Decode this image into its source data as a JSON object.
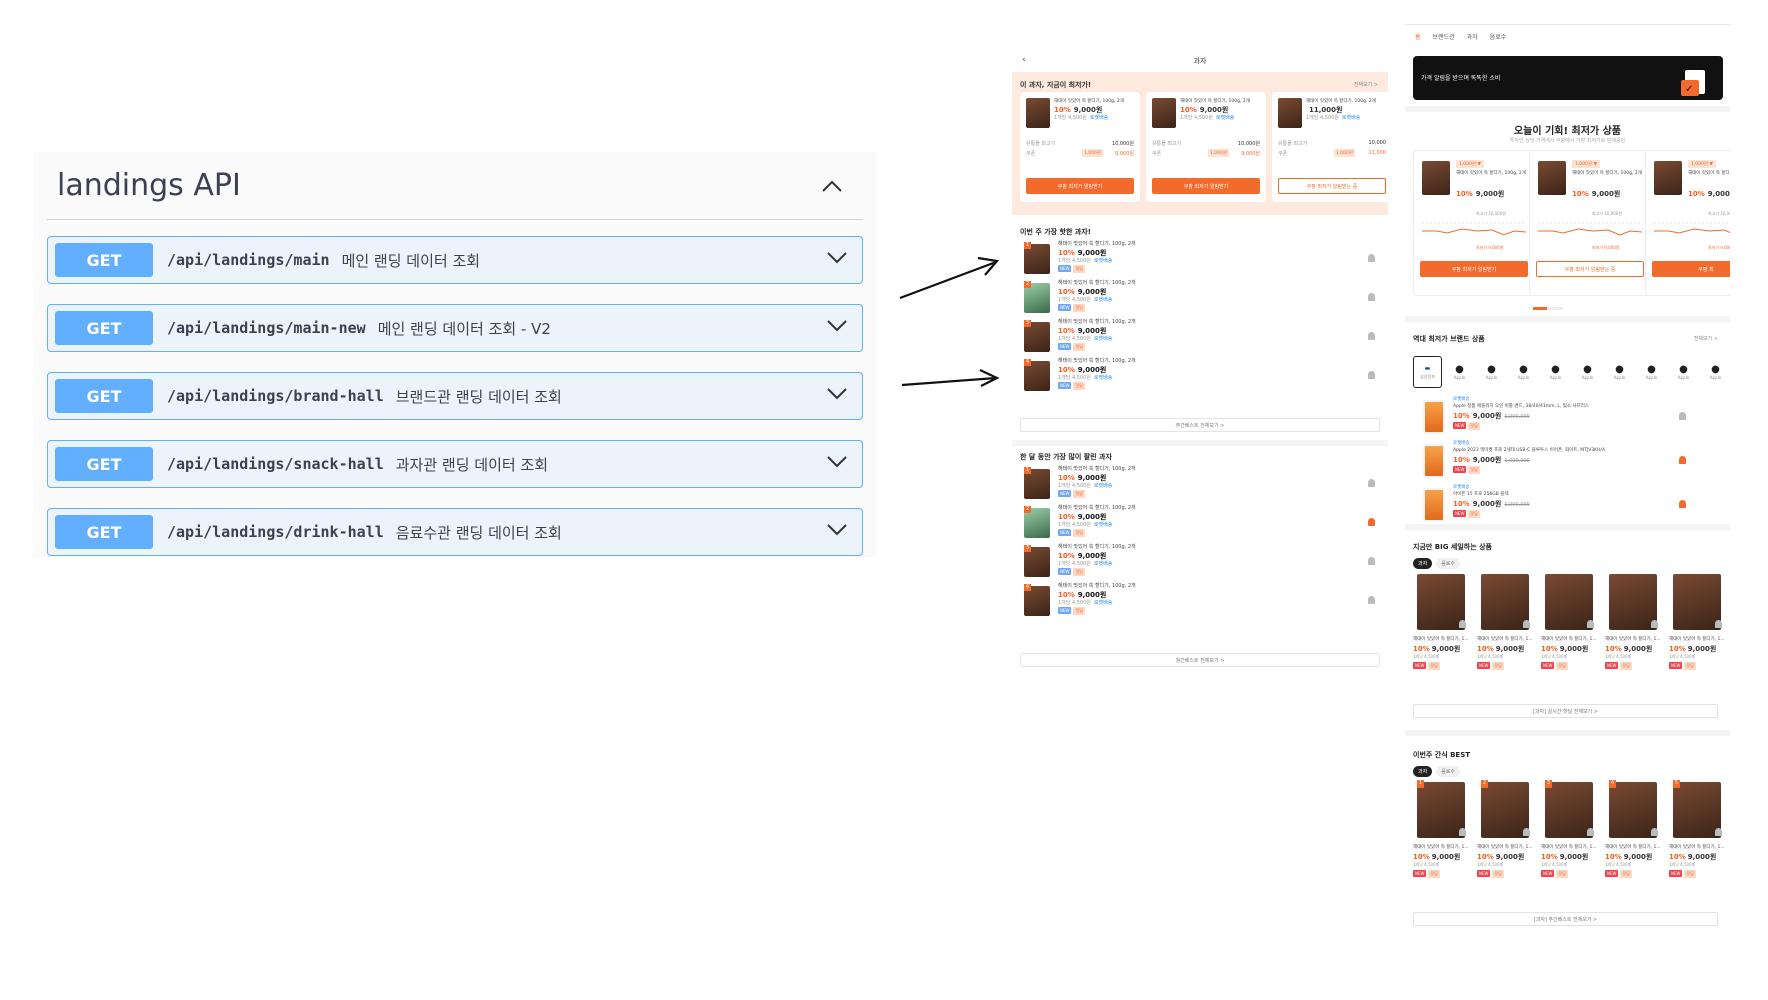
{
  "swagger": {
    "title": "landings API",
    "operations": [
      {
        "method": "GET",
        "path": "/api/landings/main",
        "description": "메인 랜딩 데이터 조회"
      },
      {
        "method": "GET",
        "path": "/api/landings/main-new",
        "description": "메인 랜딩 데이터 조회 - V2"
      },
      {
        "method": "GET",
        "path": "/api/landings/brand-hall",
        "description": "브랜드관 랜딩 데이터 조회"
      },
      {
        "method": "GET",
        "path": "/api/landings/snack-hall",
        "description": "과자관 랜딩 데이터 조회"
      },
      {
        "method": "GET",
        "path": "/api/landings/drink-hall",
        "description": "음료수관 랜딩 데이터 조회"
      }
    ]
  },
  "snack_page": {
    "header_title": "과자",
    "back_icon": "chevron-left-icon",
    "banner_title": "이 과자, 지금이 최저가!",
    "banner_more": "전체보기 >",
    "product_name": "해태이 맛있어 쏙 할디기, 100g, 2개",
    "discount": "10%",
    "price": "9,000원",
    "unit_price": "1개당 4,500원",
    "rocket": "로켓배송",
    "orig_label": "유통몰 최고가",
    "orig_value": "10,000원",
    "coupon_label": "쿠폰",
    "coupon_value": "1,000원",
    "coupon_price": "9,000원",
    "card3_price": "11,000원",
    "card3_orig": "10,000",
    "card3_coupon_price": "11,000",
    "btn_alert": "쿠팡 최저가 알림받기",
    "btn_alert_on": "쿠팡 최저가 알림받는 중",
    "week_title": "이번 주 가장 핫한 과자!",
    "week_more": "주간베스트 전체보기 >",
    "month_title": "한 달 동안 가장 많이 팔린 과자",
    "month_more": "월간베스트 전체보기 >",
    "tag_new": "NEW",
    "tag_hot": "핫딜"
  },
  "main_page": {
    "nav": [
      "홈",
      "브랜드관",
      "과자",
      "음료수"
    ],
    "hero_text": "가격 알림을 받으며 똑똑한 소비",
    "today_title": "오늘이 기회! 최저가 상품",
    "today_sub": "투자인 상당 가격에서 쿠팡에서 가장 최저가로 판매중인",
    "low_badge": "1,000원 ▼",
    "low_name": "해태이 맛있어 쏙 할디기, 100g, 2개",
    "low_discount": "10%",
    "low_price": "9,000원",
    "low_high": "최고가 10,000원",
    "low_low": "최저가 9,000원",
    "btn_alert": "쿠팡 최저가 알림받기",
    "btn_alert_on": "쿠팡 최저가 알림받는 중",
    "btn_alert_short": "쿠팡 최",
    "brand_title": "역대 최저가 브랜드 상품",
    "brand_more": "전체보기 >",
    "brands": [
      "삼성전자",
      "Apple",
      "Apple",
      "Apple",
      "Apple",
      "Apple",
      "Apple",
      "Apple",
      "Apple",
      "Apple"
    ],
    "brand_products": [
      {
        "name": "Apple 정품 애플워치 오인 비틀 밴드, 38/40/41mm, L, 빛소 사프러스",
        "discount": "10%",
        "price": "9,000원",
        "orig": "1,000,000"
      },
      {
        "name": "Apple 2023 맥미켓 프로 2세대 USB-C 블루투스 이어폰, 화이트, MTJV3KH/A",
        "discount": "10%",
        "price": "9,000원",
        "orig": "1,000,000"
      },
      {
        "name": "아이폰 15 프로 256GB 블랙",
        "discount": "10%",
        "price": "9,000원",
        "orig": "1,000,000"
      }
    ],
    "big_sale_title": "지금만 BIG 세일하는 상품",
    "chips": [
      "과자",
      "음료수"
    ],
    "grid_name": "해태이 맛있어 쏙 할디기, 1...",
    "grid_price": "9,000원",
    "grid_unit": "1개당 4,500원",
    "big_more": "[과자] 실시간 핫딜 전체보기 >",
    "best_title": "이번주 간식 BEST",
    "best_more": "[과자] 주간베스트 전체보기 >",
    "count_badge": "2+"
  },
  "colors": {
    "accent": "#f26b2c",
    "swagger_blue": "#61affe",
    "swagger_bg": "#ebf3fb"
  }
}
